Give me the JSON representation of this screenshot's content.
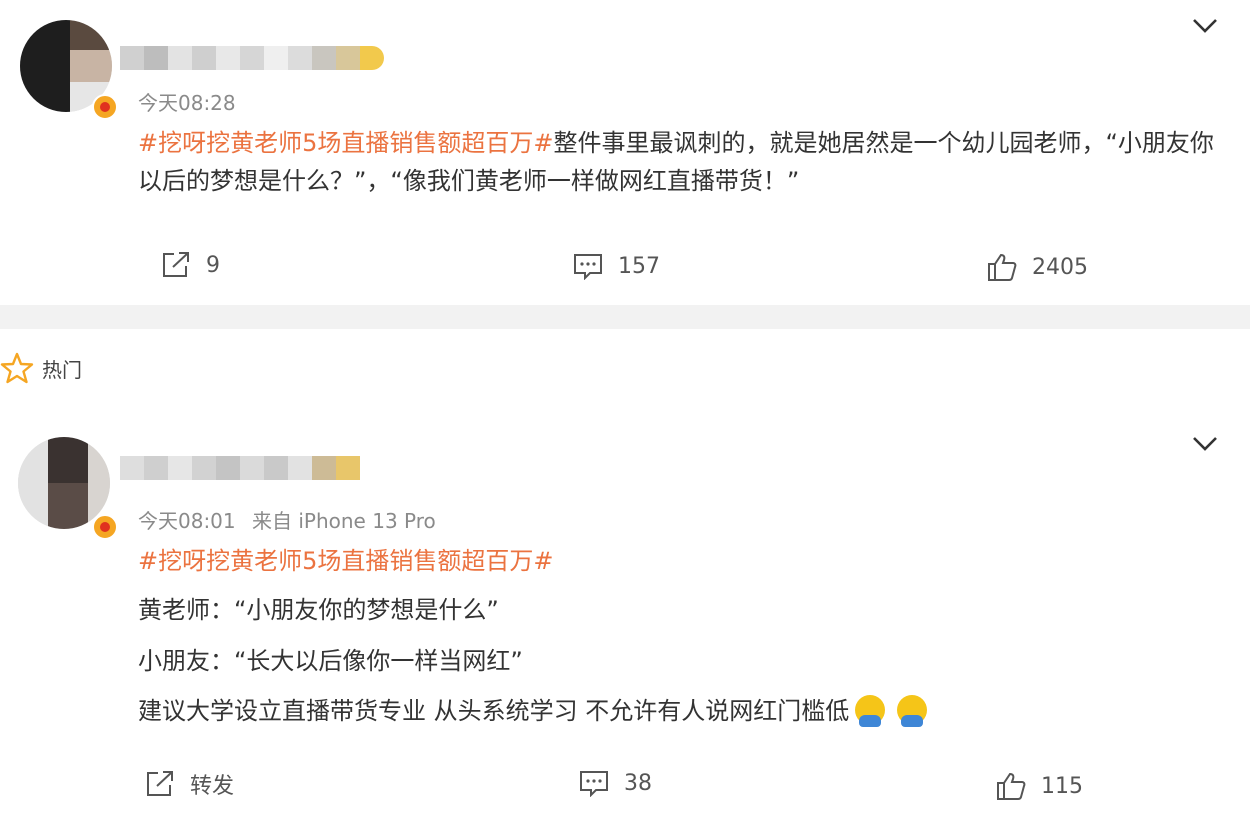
{
  "post1": {
    "time": "今天08:28",
    "hashtag": "#挖呀挖黄老师5场直播销售额超百万#",
    "body": "整件事里最讽刺的，就是她居然是一个幼儿园老师，“小朋友你以后的梦想是什么？”，“像我们黄老师一样做网红直播带货！”",
    "actions": {
      "share_count": "9",
      "comment_count": "157",
      "like_count": "2405"
    }
  },
  "section": {
    "hot_label": "热门"
  },
  "post2": {
    "time": "今天08:01",
    "source": "来自 iPhone 13 Pro",
    "hashtag": "#挖呀挖黄老师5场直播销售额超百万#",
    "line1": "黄老师：“小朋友你的梦想是什么”",
    "line2": "小朋友：“长大以后像你一样当网红”",
    "line3": "建议大学设立直播带货专业 从头系统学习 不允许有人说网红门槛低",
    "actions": {
      "share_label": "转发",
      "comment_count": "38",
      "like_count": "115"
    }
  },
  "icons": {
    "share": "share-icon",
    "comment": "comment-icon",
    "like": "thumbs-up-icon",
    "more": "chevron-down-icon",
    "hot": "star-icon",
    "emoji": "emoji-icon"
  },
  "colors": {
    "hashtag": "#eb7340",
    "meta": "#8a8a8a",
    "divider": "#f2f2f2"
  }
}
